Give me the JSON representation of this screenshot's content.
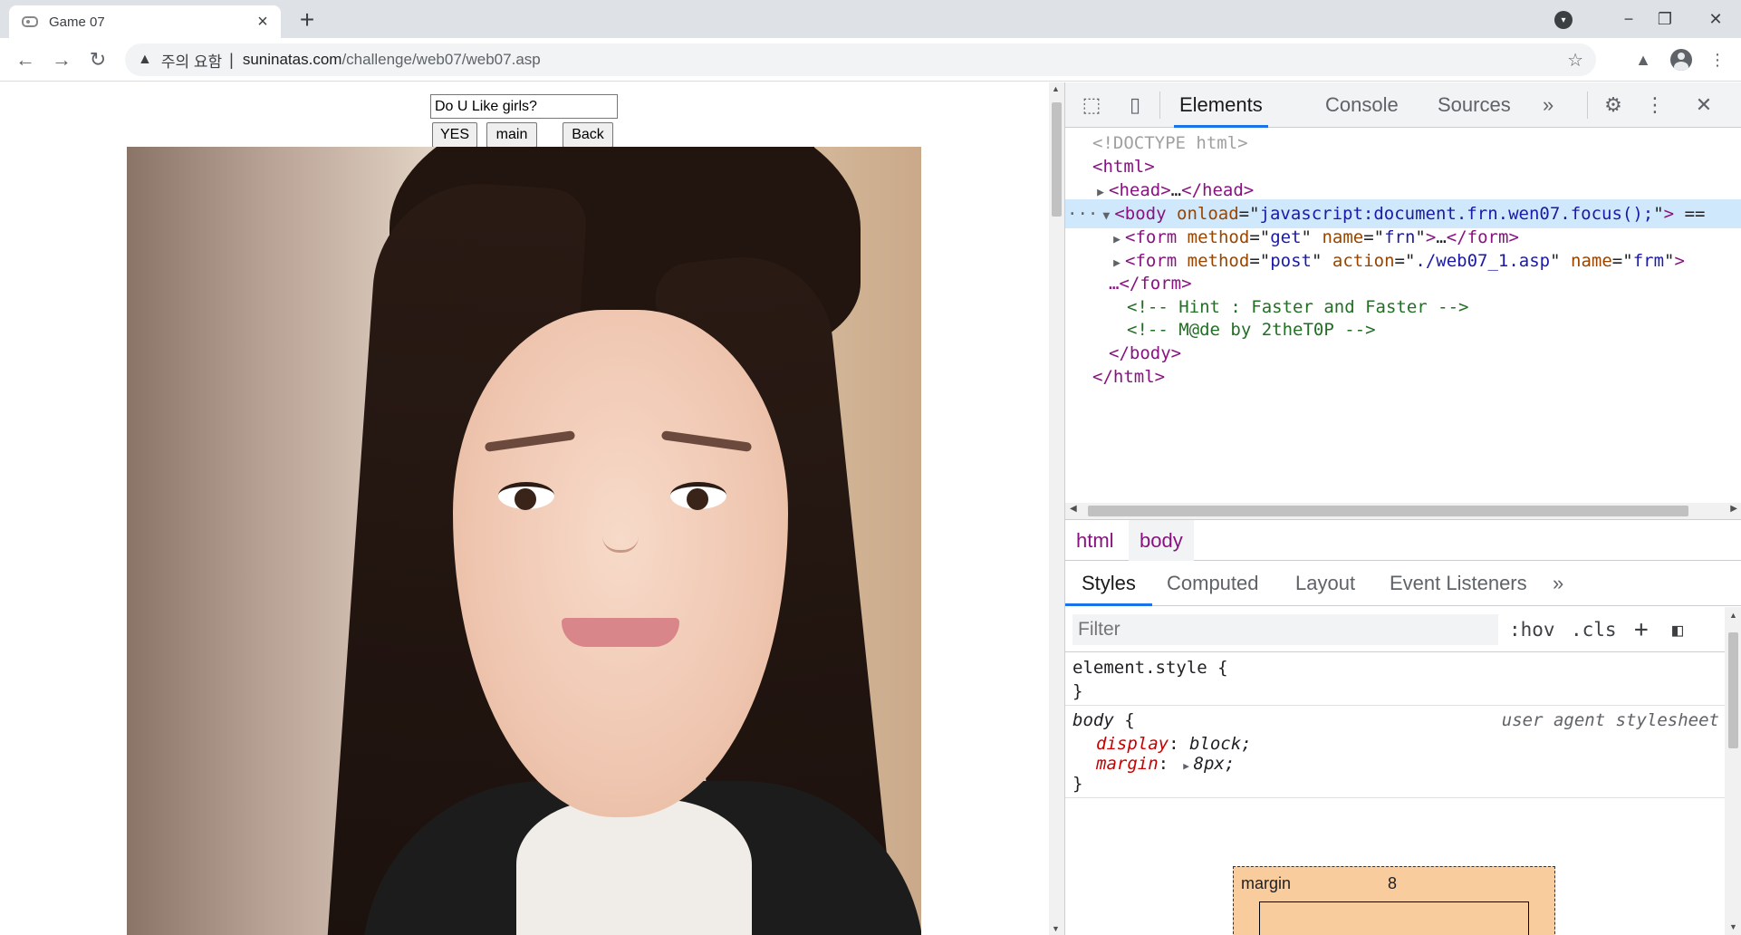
{
  "browser": {
    "tab_title": "Game 07",
    "new_tab_label": "+",
    "tab_close_label": "×",
    "minimize_label": "−",
    "restore_label": "❐",
    "close_label": "✕",
    "security_warning": "주의 요함",
    "separator": "|",
    "url_host": "suninatas.com",
    "url_path": "/challenge/web07/web07.asp"
  },
  "page": {
    "question_value": "Do U Like girls?",
    "yes_label": "YES",
    "main_label": "main",
    "back_label": "Back"
  },
  "devtools": {
    "tabs": [
      "Elements",
      "Console",
      "Sources"
    ],
    "more_tabs": "»",
    "dom": {
      "doctype": "<!DOCTYPE html>",
      "html_open": "html",
      "head": "head",
      "head_ellipsis": "…",
      "body_tag": "body",
      "body_attr": "onload",
      "body_val": "javascript:document.frn.wen07.focus();",
      "body_trail": "==",
      "form1_tag": "form",
      "form1_method_attr": "method",
      "form1_method_val": "get",
      "form1_name_attr": "name",
      "form1_name_val": "frn",
      "form2_tag": "form",
      "form2_method_attr": "method",
      "form2_method_val": "post",
      "form2_action_attr": "action",
      "form2_action_val": "./web07_1.asp",
      "form2_name_attr": "name",
      "form2_name_val": "frm",
      "form2_close": "…</form>",
      "comment1": "<!-- Hint : Faster and Faster -->",
      "comment2": "<!-- M@de by 2theT0P -->",
      "body_close": "body",
      "html_close": "html",
      "selection_marker": "···"
    },
    "breadcrumbs": [
      "html",
      "body"
    ],
    "sub_tabs": [
      "Styles",
      "Computed",
      "Layout",
      "Event Listeners"
    ],
    "filter_placeholder": "Filter",
    "hov_label": ":hov",
    "cls_label": ".cls",
    "plus_label": "+",
    "styles": {
      "element_style_open": "element.style {",
      "close_brace": "}",
      "body_selector": "body",
      "open_brace": " {",
      "ua_label": "user agent stylesheet",
      "prop1_name": "display",
      "prop1_value": "block;",
      "prop2_name": "margin",
      "prop2_value": "8px;"
    },
    "box_model": {
      "label": "margin",
      "value": "8"
    }
  }
}
